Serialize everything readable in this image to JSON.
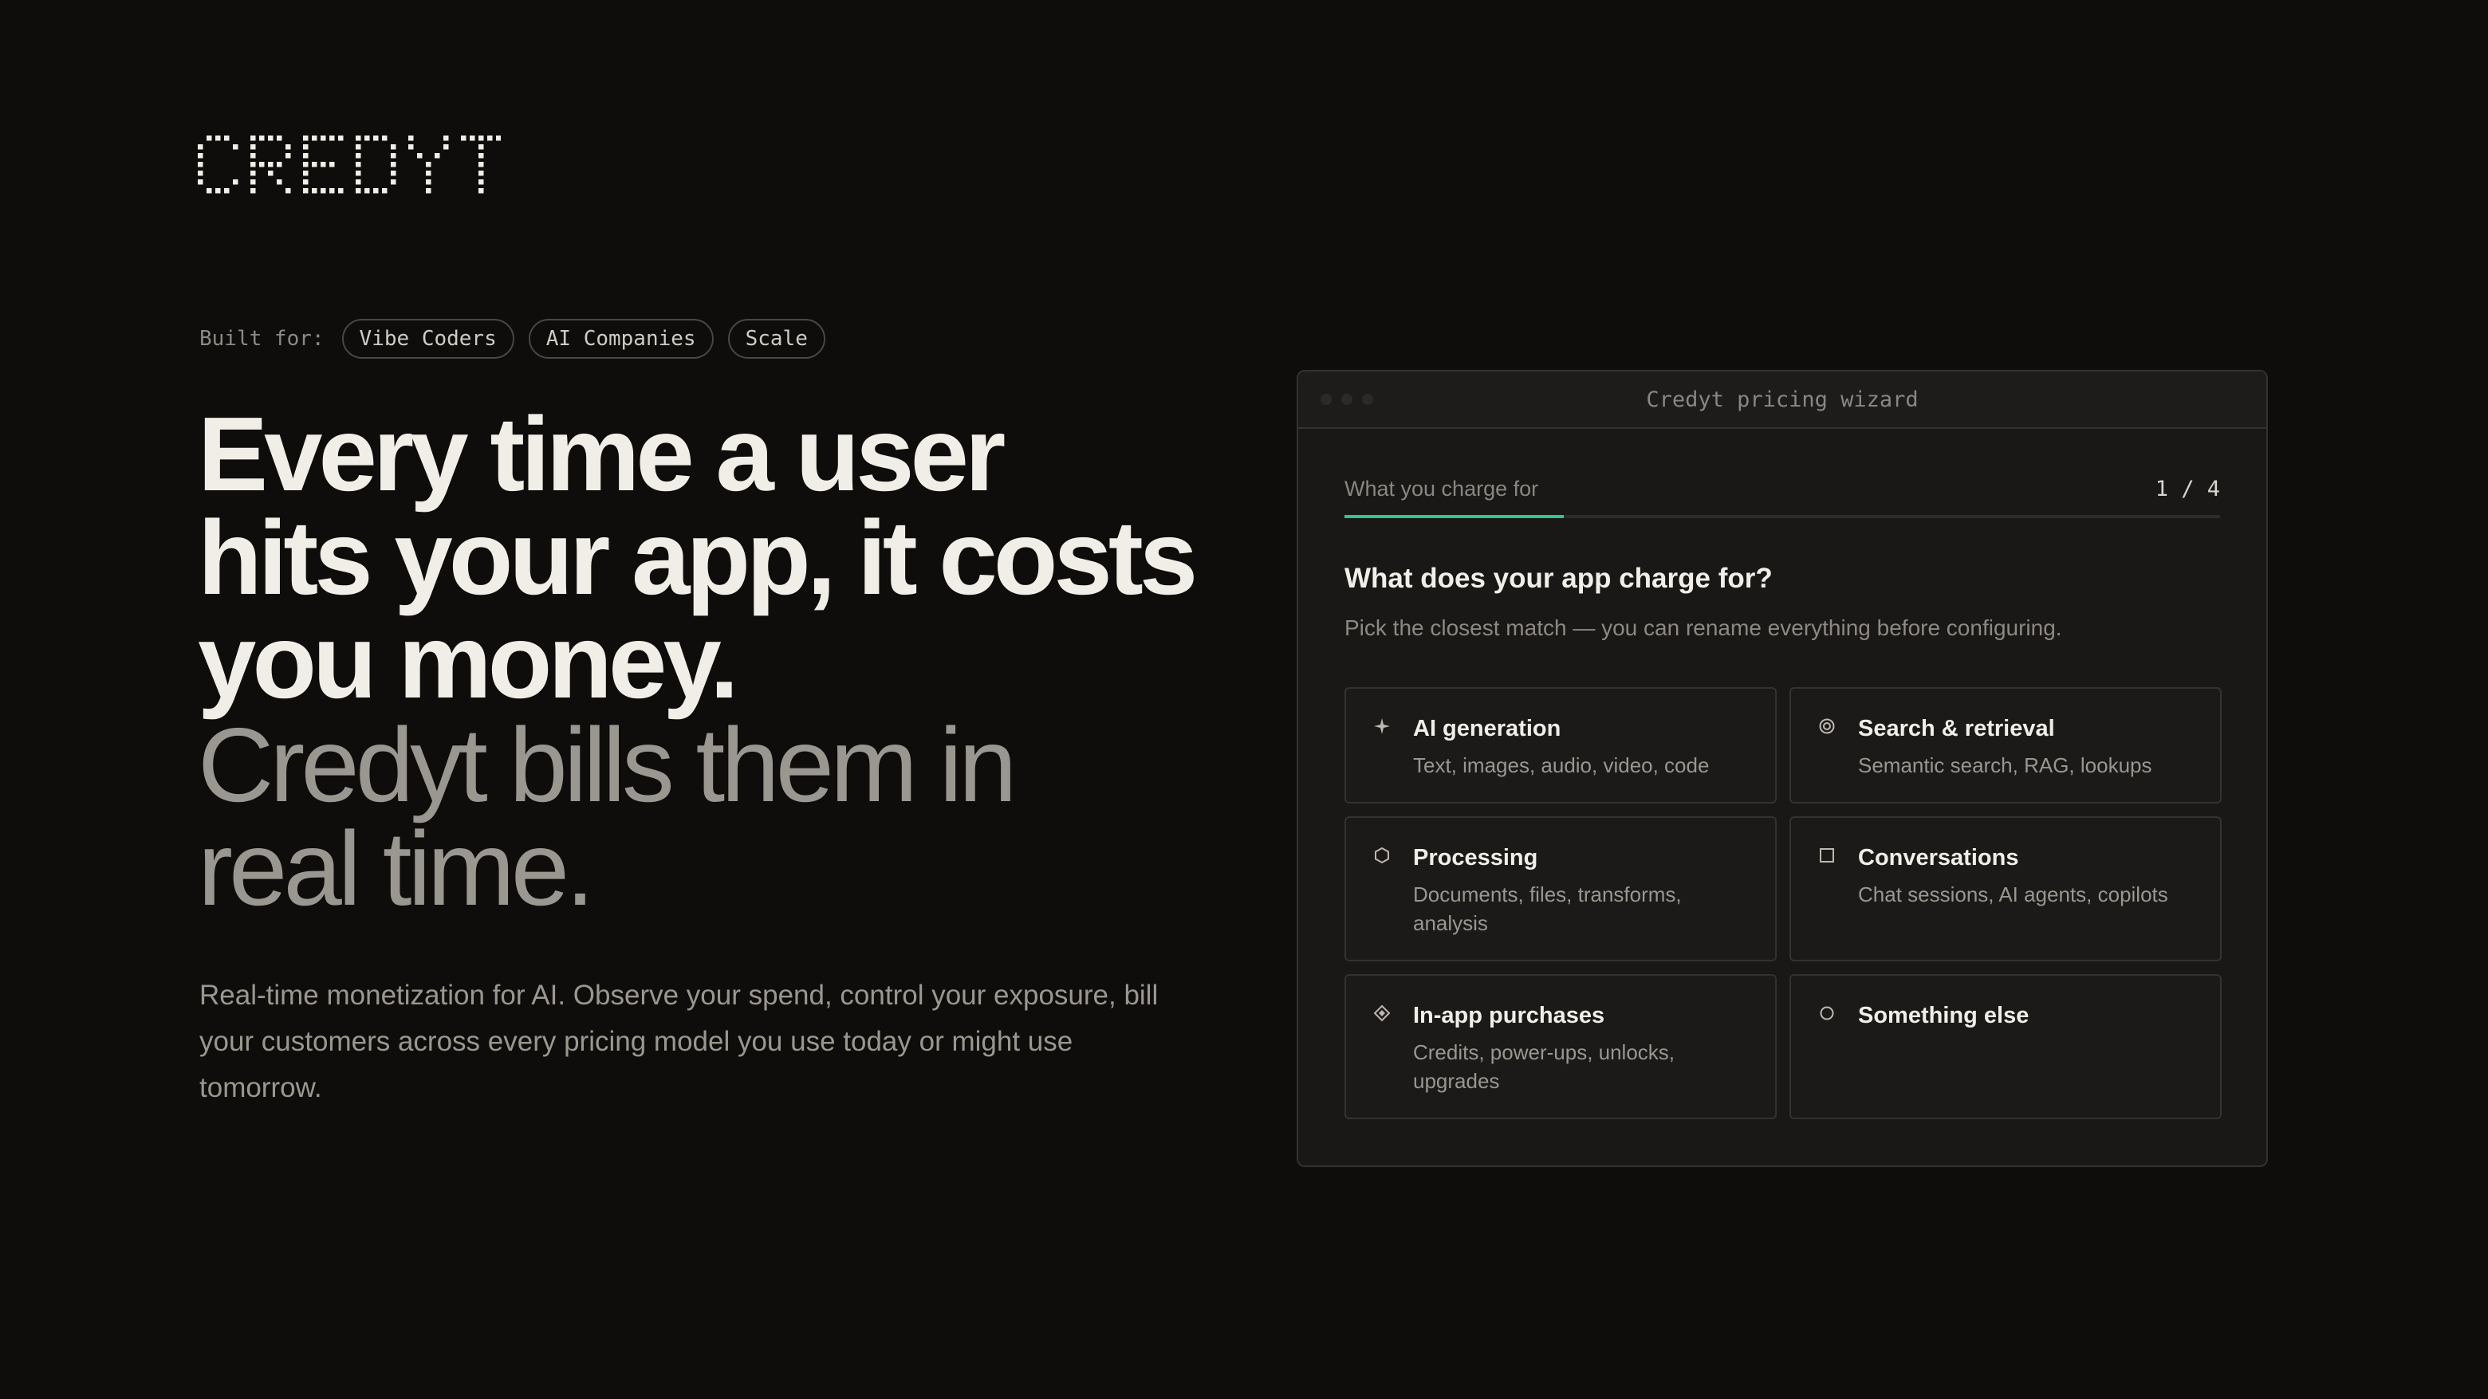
{
  "brand": {
    "logo_text": "CREDYT"
  },
  "built_for": {
    "label": "Built for:",
    "chips": [
      "Vibe Coders",
      "AI Companies",
      "Scale"
    ]
  },
  "hero": {
    "headline_strong": [
      "Every time a user",
      "hits your app, it costs",
      "you money."
    ],
    "headline_soft": [
      "Credyt bills them in",
      "real time."
    ],
    "description": "Real-time monetization for AI. Observe your spend, control your exposure, bill your customers across every pricing model you use today or might use tomorrow."
  },
  "wizard": {
    "title": "Credyt pricing wizard",
    "step_name": "What you charge for",
    "step_current": 1,
    "step_total": 4,
    "step_count_text": "1 / 4",
    "progress_fraction": 0.25,
    "accent_color": "#2fc88a",
    "question": "What does your app charge for?",
    "hint": "Pick the closest match — you can rename everything before configuring.",
    "options": [
      {
        "icon": "sparkle-icon",
        "title": "AI generation",
        "description": "Text, images, audio, video, code"
      },
      {
        "icon": "target-icon",
        "title": "Search & retrieval",
        "description": "Semantic search, RAG, lookups"
      },
      {
        "icon": "hexagon-icon",
        "title": "Processing",
        "description": "Documents, files, transforms, analysis"
      },
      {
        "icon": "square-icon",
        "title": "Conversations",
        "description": "Chat sessions, AI agents, copilots"
      },
      {
        "icon": "diamond-icon",
        "title": "In-app purchases",
        "description": "Credits, power-ups, unlocks, upgrades"
      },
      {
        "icon": "circle-icon",
        "title": "Something else",
        "description": ""
      }
    ]
  }
}
